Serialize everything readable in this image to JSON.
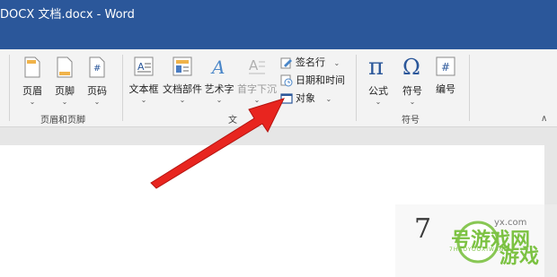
{
  "window": {
    "title": "DOCX 文档.docx  -  Word"
  },
  "ribbon": {
    "header_footer_group": {
      "label": "页眉和页脚",
      "items": [
        {
          "label": "页眉"
        },
        {
          "label": "页脚"
        },
        {
          "label": "页码"
        }
      ]
    },
    "text_group": {
      "label_fragment": "文",
      "items": [
        {
          "label": "文本框"
        },
        {
          "label": "文档部件"
        },
        {
          "label": "艺术字"
        },
        {
          "label": "首字下沉"
        }
      ],
      "small_items": [
        {
          "label": "签名行"
        },
        {
          "label": "日期和时间"
        },
        {
          "label": "对象"
        }
      ]
    },
    "symbols_group": {
      "label": "符号",
      "items": [
        {
          "label": "公式"
        },
        {
          "label": "符号"
        },
        {
          "label": "编号"
        }
      ]
    },
    "collapse_glyph": "∧"
  },
  "watermark": {
    "domain": "yx.com",
    "digit": "7",
    "brand": "号游戏网",
    "sub": "7HAOYOUXIWANG",
    "game": "游戏"
  },
  "colors": {
    "titlebar": "#2b579a",
    "arrow": "#e8251f",
    "watermark_green": "#7cc242"
  }
}
